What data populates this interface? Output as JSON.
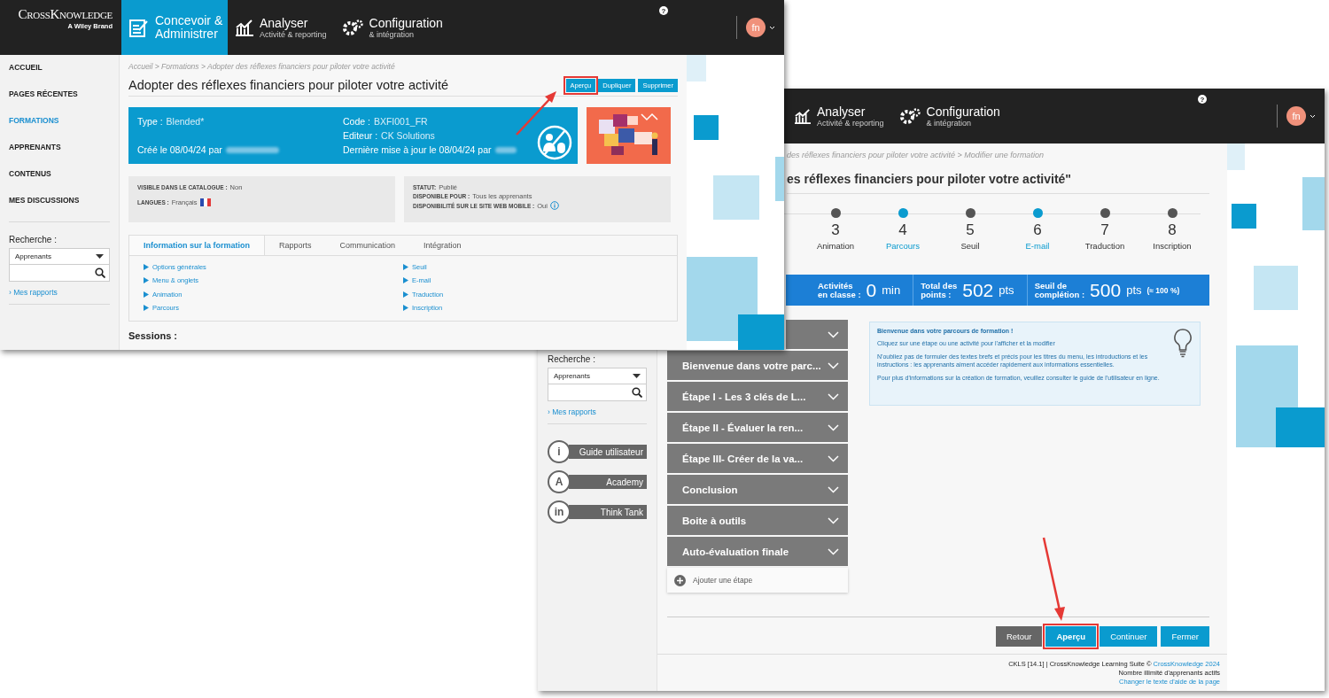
{
  "left_window": {
    "header": {
      "logo": "CrossKnowledge",
      "logo_tagline": "A Wiley Brand",
      "tabs": [
        {
          "kind": "design",
          "title": "Concevoir & Administrer",
          "selected": true
        },
        {
          "kind": "analyse",
          "title": "Analyser",
          "subtitle": "Activité & reporting",
          "selected": false
        },
        {
          "kind": "config",
          "title": "Configuration",
          "subtitle": "& intégration",
          "selected": false
        }
      ],
      "help": "?",
      "avatar": "fn"
    },
    "sidebar": {
      "items": [
        {
          "label": "ACCUEIL",
          "selected": false
        },
        {
          "label": "PAGES RÉCENTES",
          "selected": false
        },
        {
          "label": "FORMATIONS",
          "selected": true
        },
        {
          "label": "APPRENANTS",
          "selected": false
        },
        {
          "label": "CONTENUS",
          "selected": false
        },
        {
          "label": "MES DISCUSSIONS",
          "selected": false
        }
      ],
      "search": {
        "label": "Recherche :",
        "select": "Apprenants",
        "link": "› Mes rapports"
      }
    },
    "breadcrumb": "Accueil > Formations > Adopter des réflexes financiers pour piloter votre activité",
    "title": "Adopter des réflexes financiers pour piloter votre activité",
    "actions": [
      {
        "label": "Aperçu",
        "callout": true
      },
      {
        "label": "Dupliquer",
        "callout": false
      },
      {
        "label": "Supprimer",
        "callout": false
      }
    ],
    "summary": {
      "type": {
        "label": "Type :",
        "value": "Blended*"
      },
      "code": {
        "label": "Code :",
        "value": "BXFI001_FR"
      },
      "editor": {
        "label": "Editeur :",
        "value": "CK Solutions"
      },
      "created": "Créé le 08/04/24 par",
      "updated": "Dernière mise à jour le 08/04/24 par"
    },
    "status_boxes": [
      {
        "rows": [
          {
            "label": "VISIBLE DANS LE CATALOGUE :",
            "value": "Non"
          },
          {
            "label": "LANGUES :",
            "value": "Français",
            "flag": true
          }
        ]
      },
      {
        "rows": [
          {
            "label": "STATUT:",
            "value": "Publié"
          },
          {
            "label": "DISPONIBLE POUR :",
            "value": "Tous les apprenants"
          },
          {
            "label": "DISPONIBILITÉ SUR LE SITE WEB MOBILE :",
            "value": "Oui",
            "info": true
          }
        ]
      }
    ],
    "tabs": [
      {
        "label": "Information sur la formation",
        "selected": true
      },
      {
        "label": "Rapports",
        "selected": false
      },
      {
        "label": "Communication",
        "selected": false
      },
      {
        "label": "Intégration",
        "selected": false
      }
    ],
    "links": [
      [
        "Options générales",
        "Menu & onglets",
        "Animation",
        "Parcours"
      ],
      [
        "Seuil",
        "E-mail",
        "Traduction",
        "Inscription"
      ]
    ],
    "sessions_heading": "Sessions :"
  },
  "right_window": {
    "header": {
      "tabs": [
        {
          "kind": "analyse",
          "title": "Analyser",
          "subtitle": "Activité & reporting"
        },
        {
          "kind": "config",
          "title": "Configuration",
          "subtitle": "& intégration"
        }
      ],
      "help": "?",
      "avatar": "fn"
    },
    "breadcrumb": "des réflexes financiers pour piloter votre activité > Modifier une formation",
    "title": "es réflexes financiers pour piloter votre activité\"",
    "steps": [
      {
        "number": "3",
        "label": "Animation",
        "active": false
      },
      {
        "number": "4",
        "label": "Parcours",
        "active": true
      },
      {
        "number": "5",
        "label": "Seuil",
        "active": false
      },
      {
        "number": "6",
        "label": "E-mail",
        "active": true
      },
      {
        "number": "7",
        "label": "Traduction",
        "active": false
      },
      {
        "number": "8",
        "label": "Inscription",
        "active": false
      }
    ],
    "stats": [
      {
        "label": [
          "Activités",
          "en classe :"
        ],
        "value": "0",
        "unit": "min"
      },
      {
        "label": [
          "Total des",
          "points :"
        ],
        "value": "502",
        "unit": "pts"
      },
      {
        "label": [
          "Seuil de",
          "complétion :"
        ],
        "value": "500",
        "unit": "pts",
        "note": "(≈ 100 %)"
      }
    ],
    "stages": [
      "Bienvenue dans votre parc...",
      "Étape I - Les 3 clés de L...",
      "Étape II - Évaluer la ren...",
      "Étape III- Créer de la va...",
      "Conclusion",
      "Boite à outils",
      "Auto-évaluation finale"
    ],
    "add_stage": "Ajouter une étape",
    "info": {
      "heading": "Bienvenue dans votre parcours de formation !",
      "paragraphs": [
        "Cliquez sur une étape ou une activité pour l'afficher et la modifier",
        "N'oubliez pas de formuler des textes brefs et précis pour les titres du menu, les introductions et les instructions : les apprenants aiment accéder rapidement aux informations essentielles.",
        "Pour plus d'informations sur la création de formation, veuillez consulter le guide de l'utilisateur en ligne."
      ]
    },
    "sidebar": {
      "search": {
        "label": "Recherche :",
        "select": "Apprenants",
        "link": "› Mes rapports"
      },
      "resources": [
        {
          "symbol": "i",
          "label": "Guide utilisateur"
        },
        {
          "symbol": "A",
          "label": "Academy"
        },
        {
          "symbol": "in",
          "label": "Think Tank"
        }
      ]
    },
    "buttons": [
      {
        "label": "Retour",
        "kind": "secondary",
        "callout": false
      },
      {
        "label": "Aperçu",
        "kind": "primary",
        "callout": true
      },
      {
        "label": "Continuer",
        "kind": "primary",
        "callout": false
      },
      {
        "label": "Fermer",
        "kind": "primary",
        "callout": false
      }
    ],
    "footer": {
      "copyright": "CKLS [14.1] | CrossKnowledge Learning Suite © ",
      "copyright_link": "CrossKnowledge 2024",
      "learners": "Nombre illimité d'apprenants actifs",
      "help_link": "Changer le texte d'aide de la page"
    }
  }
}
